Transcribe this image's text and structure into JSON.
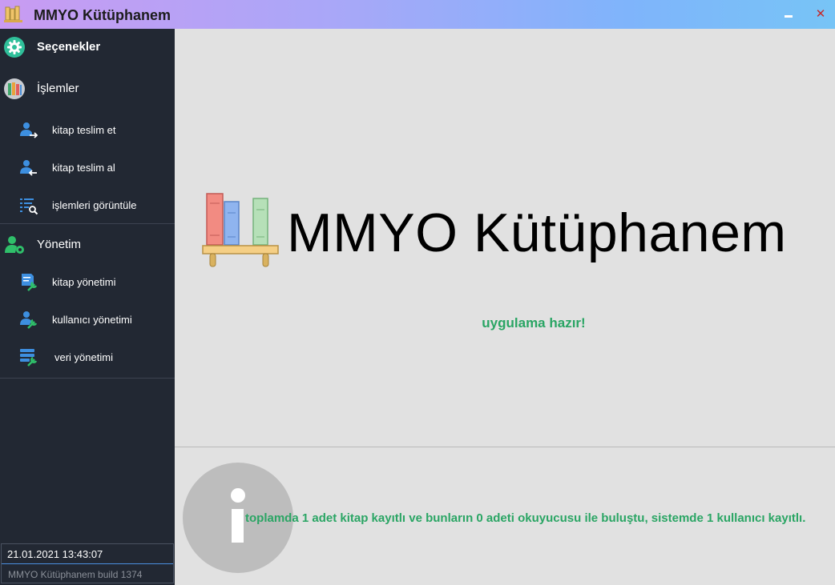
{
  "window": {
    "title": "MMYO Kütüphanem",
    "close_glyph": "✕"
  },
  "sidebar": {
    "options": {
      "label": "Seçenekler",
      "icon": "gear-icon"
    },
    "operations": {
      "label": "İşlemler",
      "icon": "books-icon",
      "items": [
        {
          "label": "kitap teslim et",
          "icon": "user-arrow-right-icon"
        },
        {
          "label": "kitap teslim al",
          "icon": "user-arrow-left-icon"
        },
        {
          "label": "işlemleri görüntüle",
          "icon": "list-search-icon"
        }
      ]
    },
    "management": {
      "label": "Yönetim",
      "icon": "user-gear-icon",
      "items": [
        {
          "label": "kitap yönetimi",
          "icon": "book-wrench-icon"
        },
        {
          "label": "kullanıcı yönetimi",
          "icon": "user-wrench-icon"
        },
        {
          "label": "veri yönetimi",
          "icon": "database-wrench-icon"
        }
      ]
    },
    "status": {
      "datetime": "21.01.2021 13:43:07",
      "build": "MMYO Kütüphanem build 1374"
    }
  },
  "main": {
    "hero_title": "MMYO Kütüphanem",
    "status_message": "uygulama hazır!",
    "info_message": "toplamda 1 adet kitap kayıtlı ve bunların 0 adeti okuyucusu ile buluştu, sistemde 1 kullanıcı kayıtlı."
  },
  "colors": {
    "sidebar_bg": "#222833",
    "main_bg": "#e1e1e1",
    "accent_green": "#2aa564",
    "icon_blue": "#3d8fe0",
    "title_gradient": [
      "#c99bf2",
      "#77c4f6"
    ]
  }
}
